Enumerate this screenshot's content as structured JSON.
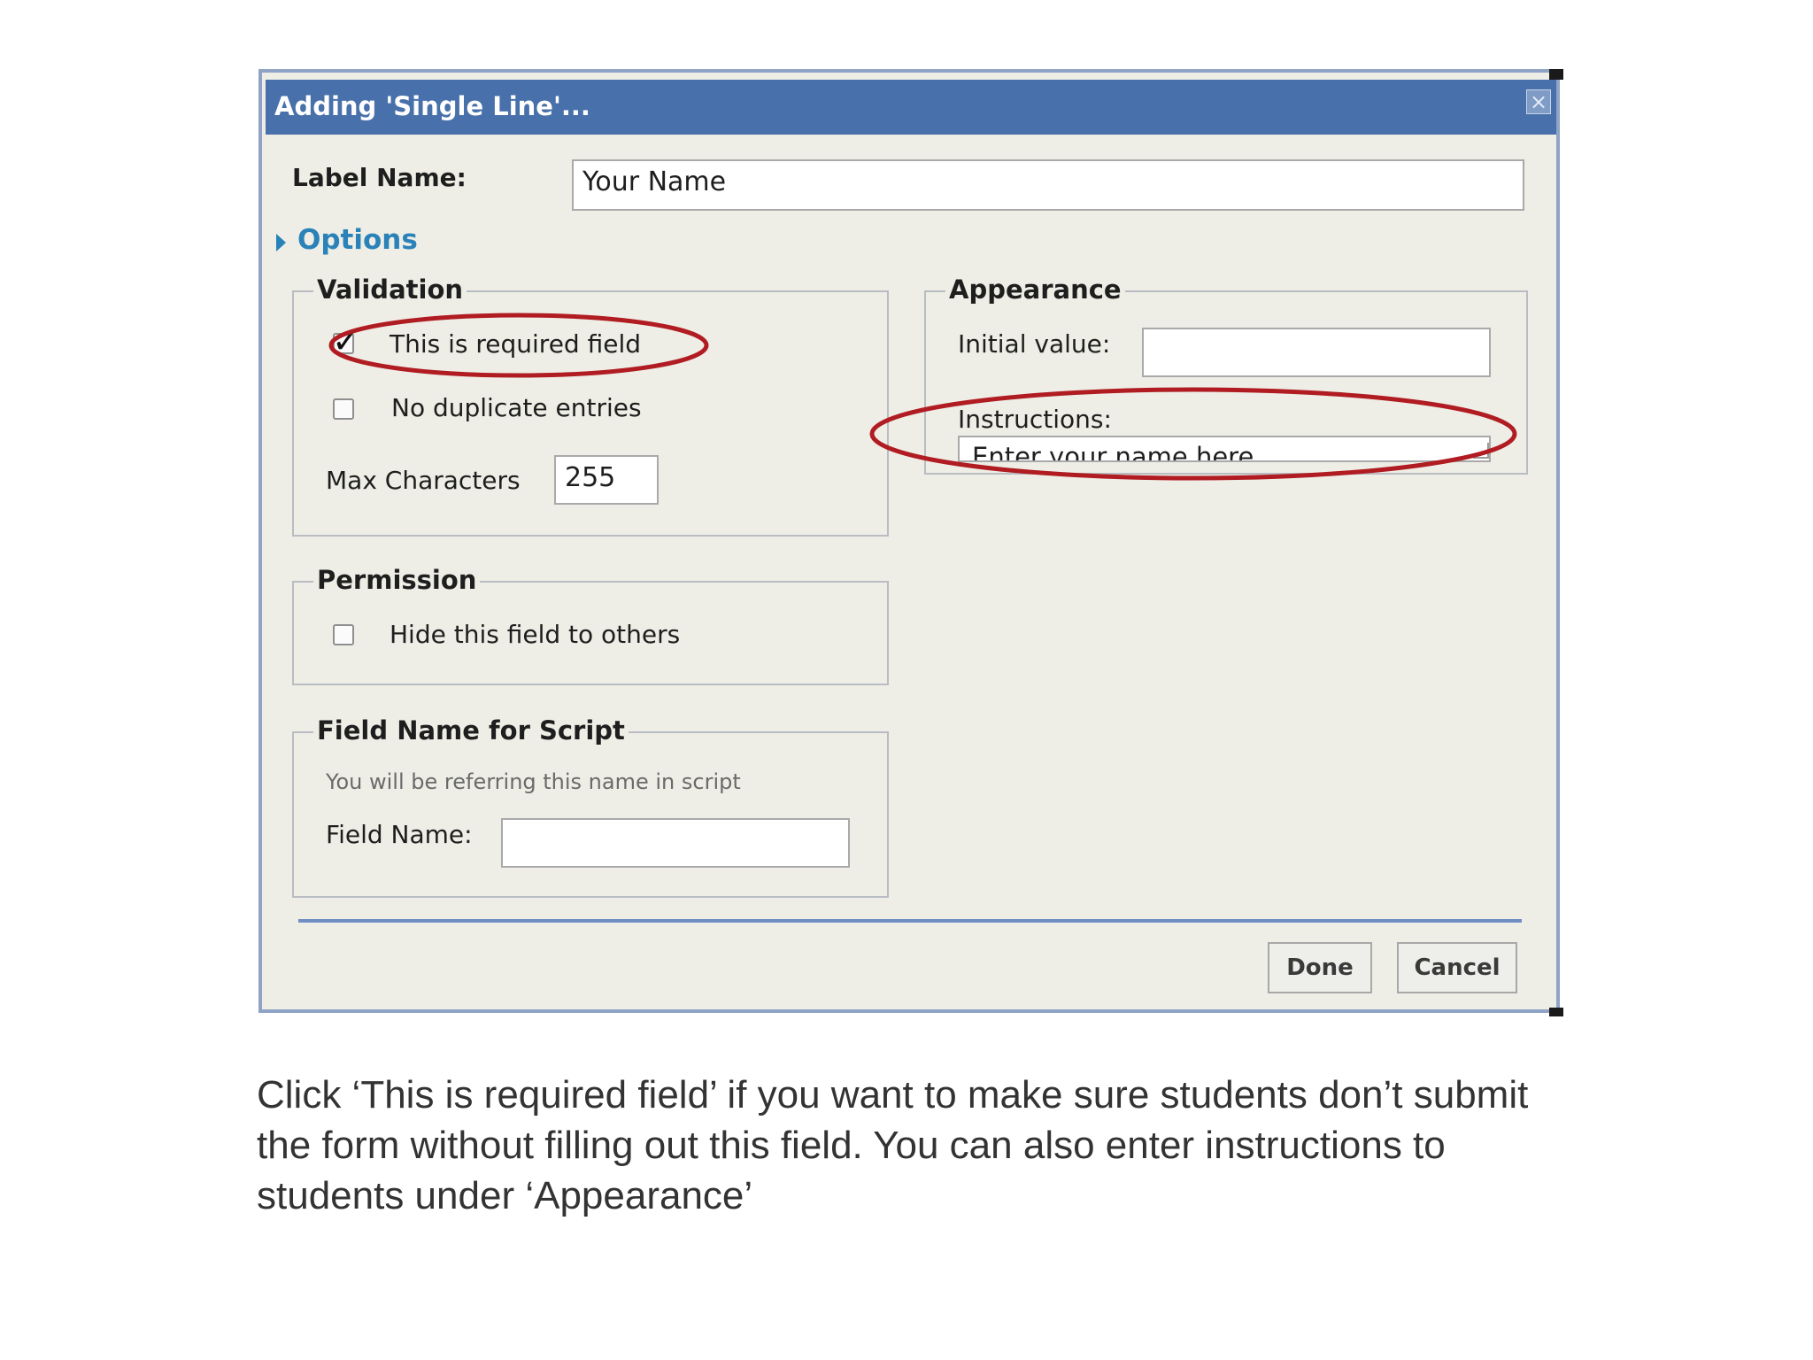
{
  "dialog": {
    "title": "Adding 'Single Line'...",
    "close_icon": "×",
    "label_name": {
      "label": "Label Name:",
      "value": "Your Name"
    },
    "options_label": "Options"
  },
  "validation": {
    "legend": "Validation",
    "required": {
      "label": "This is required field",
      "checked": "✓"
    },
    "no_duplicate": {
      "label": "No duplicate entries"
    },
    "max_characters": {
      "label": "Max Characters",
      "value": "255"
    }
  },
  "appearance": {
    "legend": "Appearance",
    "initial_value": {
      "label": "Initial value:",
      "value": ""
    },
    "instructions": {
      "label": "Instructions:",
      "value": "Enter your name here"
    }
  },
  "permission": {
    "legend": "Permission",
    "hide_field": {
      "label": "Hide this field to others"
    }
  },
  "field_name_script": {
    "legend": "Field Name for Script",
    "hint": "You will be referring this name in script",
    "field_name": {
      "label": "Field Name:",
      "value": ""
    }
  },
  "buttons": {
    "done": "Done",
    "cancel": "Cancel"
  },
  "caption": "Click ‘This is required field’ if you want to make sure students don’t submit the form without filling out this field. You can also enter instructions to students under ‘Appearance’",
  "colors": {
    "titlebar": "#4870aa",
    "dialog_bg": "#eeeee6",
    "options_link": "#2a82b8",
    "annotation_circle": "#b01c22"
  }
}
